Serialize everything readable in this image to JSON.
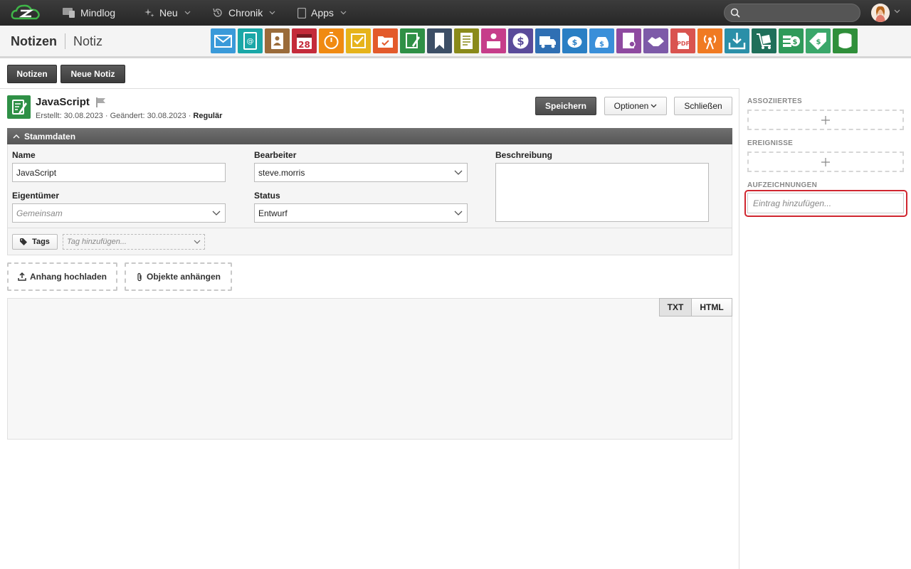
{
  "topbar": {
    "nav": [
      {
        "label": "Mindlog",
        "icon": "devices-icon"
      },
      {
        "label": "Neu",
        "icon": "sparkle-icon"
      },
      {
        "label": "Chronik",
        "icon": "history-icon"
      },
      {
        "label": "Apps",
        "icon": "tablet-icon"
      }
    ]
  },
  "header": {
    "title": "Notizen",
    "subtitle": "Notiz",
    "apps": [
      {
        "name": "mail",
        "color": "#3a9ad9"
      },
      {
        "name": "address-book",
        "color": "#1aa7a7"
      },
      {
        "name": "contacts",
        "color": "#9a6b3a"
      },
      {
        "name": "calendar",
        "color": "#c42b3a",
        "text": "28"
      },
      {
        "name": "timer",
        "color": "#f08a12"
      },
      {
        "name": "tasks",
        "color": "#e6b31a"
      },
      {
        "name": "projects",
        "color": "#e35a2b"
      },
      {
        "name": "notes",
        "color": "#2f9046"
      },
      {
        "name": "bookmarks",
        "color": "#3d4f66"
      },
      {
        "name": "documents",
        "color": "#8a8a1a"
      },
      {
        "name": "support",
        "color": "#c63d8a"
      },
      {
        "name": "finance",
        "color": "#5a4b9a"
      },
      {
        "name": "delivery",
        "color": "#2f6fb3"
      },
      {
        "name": "piggy-bank",
        "color": "#2a7fc4"
      },
      {
        "name": "money-bag",
        "color": "#3a8fd9"
      },
      {
        "name": "contracts",
        "color": "#8e4aa0"
      },
      {
        "name": "deals",
        "color": "#7d5aa8"
      },
      {
        "name": "pdf",
        "color": "#d9534f"
      },
      {
        "name": "broadcast",
        "color": "#f07a22"
      },
      {
        "name": "download",
        "color": "#2b8fa8"
      },
      {
        "name": "shipping",
        "color": "#1f6f5a"
      },
      {
        "name": "cash",
        "color": "#2f9a5a"
      },
      {
        "name": "pricing",
        "color": "#3aa76a"
      },
      {
        "name": "database",
        "color": "#2f8f3a"
      }
    ]
  },
  "toolbar": {
    "notizen_label": "Notizen",
    "neue_notiz_label": "Neue Notiz"
  },
  "note": {
    "title": "JavaScript",
    "created_label": "Erstellt:",
    "created": "30.08.2023",
    "changed_label": "Geändert:",
    "changed": "30.08.2023",
    "type": "Regulär",
    "save_label": "Speichern",
    "options_label": "Optionen",
    "close_label": "Schließen"
  },
  "stammdaten": {
    "section_title": "Stammdaten",
    "name_label": "Name",
    "name_value": "JavaScript",
    "bearbeiter_label": "Bearbeiter",
    "bearbeiter_value": "steve.morris",
    "beschreibung_label": "Beschreibung",
    "eigentuemer_label": "Eigentümer",
    "eigentuemer_placeholder": "Gemeinsam",
    "status_label": "Status",
    "status_value": "Entwurf",
    "tags_label": "Tags",
    "tag_placeholder": "Tag hinzufügen..."
  },
  "attachments": {
    "upload_label": "Anhang hochladen",
    "attach_label": "Objekte anhängen"
  },
  "editor": {
    "txt_label": "TXT",
    "html_label": "HTML"
  },
  "sidebar": {
    "assoziiertes_label": "ASSOZIIERTES",
    "ereignisse_label": "EREIGNISSE",
    "aufzeichnungen_label": "AUFZEICHNUNGEN",
    "entry_placeholder": "Eintrag hinzufügen..."
  }
}
